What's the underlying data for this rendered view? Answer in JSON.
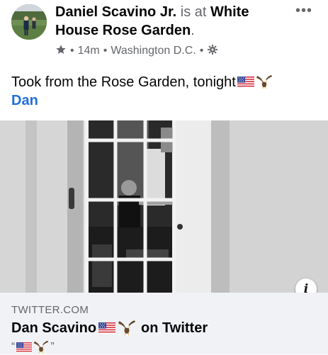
{
  "post": {
    "author_name": "Daniel Scavino Jr.",
    "is_at_text": "is at",
    "location_name": "White House Rose Garden",
    "location_suffix": ".",
    "time": "14m",
    "place": "Washington D.C.",
    "separator": "•",
    "more_label": "•••",
    "caption_text": "Took from the Rose Garden, tonight",
    "caption_mention": "Dan",
    "icons": [
      "star-icon",
      "gear-icon",
      "us-flag-emoji",
      "eagle-emoji",
      "info-icon"
    ]
  },
  "link_preview": {
    "domain": "TWITTER.COM",
    "title_prefix": "Dan Scavino",
    "title_suffix": "on Twitter",
    "desc_open": "“",
    "desc_close": "”"
  },
  "colors": {
    "mention": "#216fdb",
    "muted": "#65676b",
    "card_bg": "#f0f2f5"
  }
}
